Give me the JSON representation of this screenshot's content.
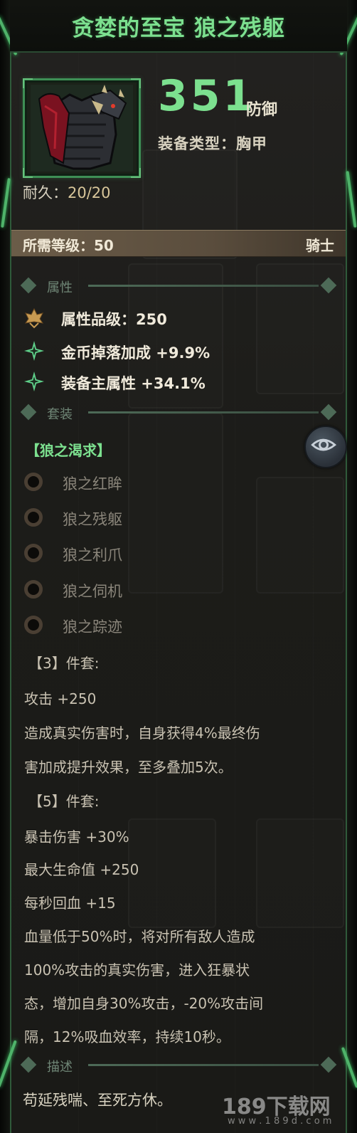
{
  "title": "贪婪的至宝 狼之残躯",
  "stat": {
    "value": "351",
    "unit": "防御"
  },
  "equip_type": "装备类型：胸甲",
  "durability": {
    "label": "耐久：",
    "value": "20/20"
  },
  "requirement": {
    "label": "所需等级：50",
    "class": "骑士"
  },
  "sections": {
    "attributes": "属性",
    "set": "套装",
    "description": "描述"
  },
  "attributes": [
    {
      "text": "属性品级：250",
      "icon": "quality-crest-icon"
    },
    {
      "text": "金币掉落加成 +9.9%",
      "icon": "green-sparkle-icon"
    },
    {
      "text": "装备主属性 +34.1%",
      "icon": "green-sparkle-icon"
    }
  ],
  "set": {
    "name": "【狼之渴求】",
    "items": [
      "狼之红眸",
      "狼之残躯",
      "狼之利爪",
      "狼之伺机",
      "狼之踪迹"
    ]
  },
  "bonus3": {
    "heading": "【3】件套:",
    "lines": [
      "攻击 +250",
      "造成真实伤害时，自身获得4%最终伤",
      "害加成提升效果，至多叠加5次。"
    ]
  },
  "bonus5": {
    "heading": "【5】件套:",
    "lines": [
      "暴击伤害 +30%",
      "最大生命值 +250",
      "每秒回血 +15",
      "血量低于50%时，将对所有敌人造成",
      "100%攻击的真实伤害，进入狂暴状",
      "态，增加自身30%攻击，-20%攻击间",
      "隔，12%吸血效率，持续10秒。"
    ]
  },
  "description_text": "苟延残喘、至死方休。",
  "watermark": {
    "main": "189下载网",
    "sub": "w w w . 1 8 9 d . c o m"
  },
  "colors": {
    "accent_green": "#7ce08f",
    "frame_green": "#3e8f55",
    "requirement_bar": "#6b5c48"
  },
  "icons": {
    "eye_button": "eye-icon"
  }
}
